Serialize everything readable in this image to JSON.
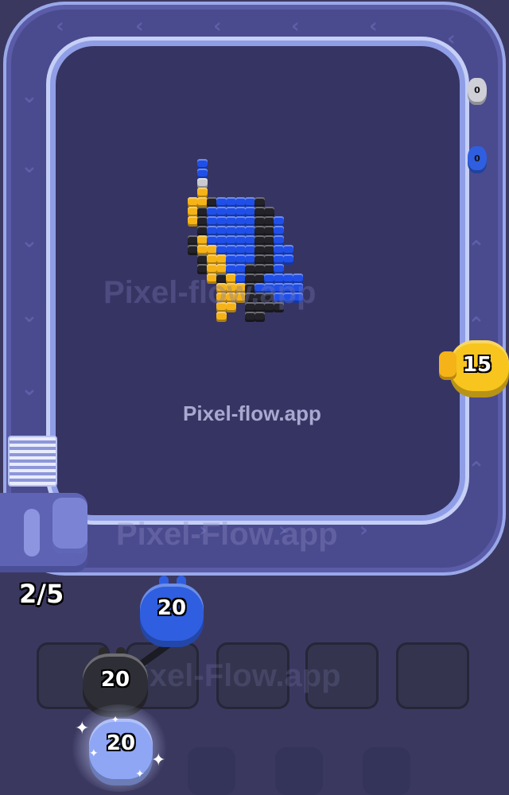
{
  "watermark": {
    "center": "Pixel-flow.app",
    "faint_top": "Pixel-flow.app",
    "faint_bottom": "Pixel-Flow.app",
    "faint_slots": "Pixel-Flow.app"
  },
  "progress": {
    "label": "2/5",
    "current": 2,
    "total": 5
  },
  "pigs": {
    "yellow_on_track": {
      "count": "15",
      "color": "#f7c51e"
    },
    "blue_launching": {
      "count": "20",
      "color": "#2f5fe0"
    },
    "black_queued": {
      "count": "20",
      "color": "#2a2a2a"
    },
    "blue_selected": {
      "count": "20",
      "color": "#6f8cf0"
    },
    "gray_waiting": {
      "count": "0",
      "color": "#cfcfd8"
    },
    "blue_waiting": {
      "count": "0",
      "color": "#2f5fe0"
    }
  },
  "colors": {
    "background": "#3b3860",
    "track": "#4a4a8e",
    "board": "#363463",
    "pixel_blue": "#1f4fe8",
    "pixel_black": "#222228",
    "pixel_yellow": "#f5b318",
    "pixel_gray": "#c9c9cf"
  },
  "slots": {
    "holding_slots": 5
  }
}
